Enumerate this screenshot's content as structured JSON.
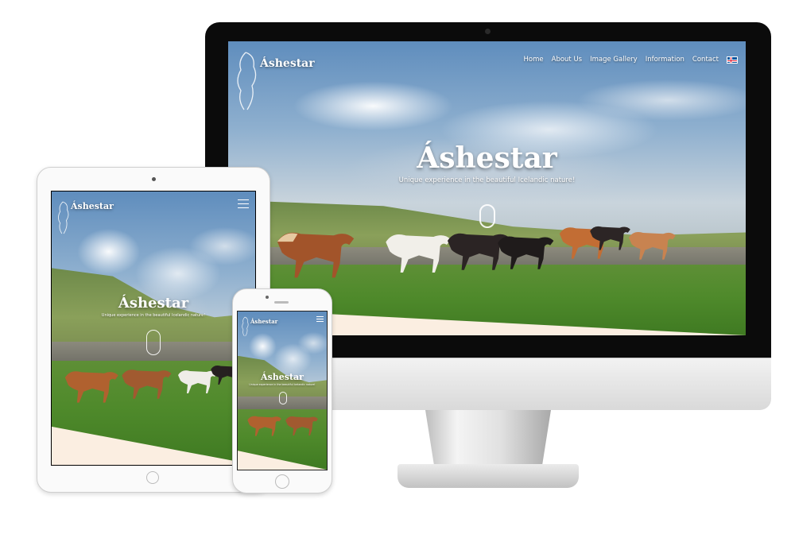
{
  "site": {
    "brand": "Áshestar",
    "tagline": "Unique experience in the beautiful Icelandic nature!"
  },
  "desktop": {
    "nav": [
      "Home",
      "About Us",
      "Image Gallery",
      "Information",
      "Contact"
    ],
    "language_icon": "iceland-flag-icon"
  },
  "tablet": {
    "menu_icon": "hamburger-menu-icon"
  },
  "mobile": {
    "menu_icon": "hamburger-menu-icon"
  },
  "colors": {
    "accent_cream": "#fbeee1",
    "bezel": "#0b0b0b",
    "flag_blue": "#02529c",
    "flag_red": "#dc1e35"
  }
}
